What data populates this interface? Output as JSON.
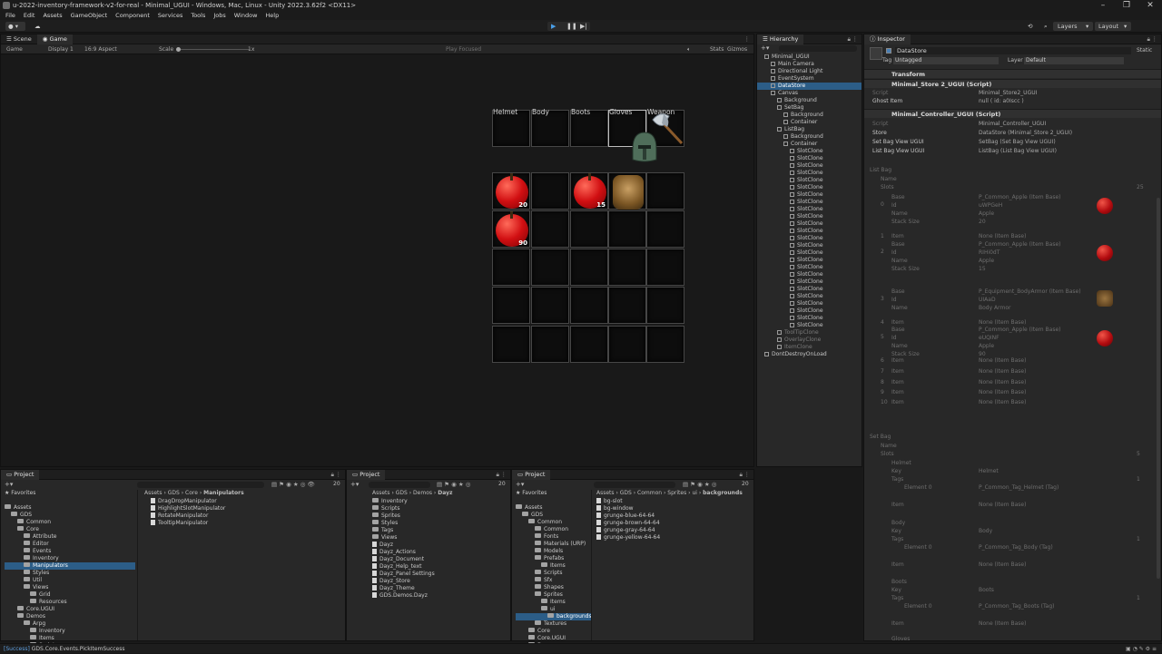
{
  "window": {
    "title": "u-2022-inventory-framework-v2-for-real - Minimal_UGUI - Windows, Mac, Linux - Unity 2022.3.62f2 <DX11>"
  },
  "menu": [
    "File",
    "Edit",
    "Assets",
    "GameObject",
    "Component",
    "Services",
    "Tools",
    "Jobs",
    "Window",
    "Help"
  ],
  "toolbar": {
    "layers": "Layers",
    "layout": "Layout"
  },
  "scene_tabs": {
    "scene": "Scene",
    "game": "Game"
  },
  "game_toolbar": {
    "mode": "Game",
    "display": "Display 1",
    "aspect": "16:9 Aspect",
    "scale_label": "Scale",
    "scale_value": "1x",
    "play_focused": "Play Focused",
    "stats": "Stats",
    "gizmos": "Gizmos"
  },
  "inventory": {
    "slot_labels": [
      "Helmet",
      "Body",
      "Boots",
      "Gloves",
      "Weapon"
    ],
    "counts": {
      "apple1": "20",
      "apple2": "15",
      "apple3": "90"
    }
  },
  "hierarchy": {
    "tab": "Hierarchy",
    "rows": [
      "Minimal_UGUI",
      "Main Camera",
      "Directional Light",
      "EventSystem",
      "DataStore",
      "Canvas",
      "Background",
      "SetBag",
      "Background",
      "Container",
      "ListBag",
      "Background",
      "Container",
      "SlotClone",
      "SlotClone",
      "SlotClone",
      "SlotClone",
      "SlotClone",
      "SlotClone",
      "SlotClone",
      "SlotClone",
      "SlotClone",
      "SlotClone",
      "SlotClone",
      "SlotClone",
      "SlotClone",
      "SlotClone",
      "SlotClone",
      "SlotClone",
      "SlotClone",
      "SlotClone",
      "SlotClone",
      "SlotClone",
      "SlotClone",
      "SlotClone",
      "SlotClone",
      "SlotClone",
      "SlotClone",
      "ToolTipClone",
      "OverlayClone",
      "ItemClone",
      "DontDestroyOnLoad"
    ],
    "selected": "DataStore"
  },
  "inspector": {
    "tab": "Inspector",
    "object_name": "DataStore",
    "static_label": "Static",
    "tag_label": "Tag",
    "tag_value": "Untagged",
    "layer_label": "Layer",
    "layer_value": "Default",
    "transform": "Transform",
    "store_script": "Minimal_Store 2_UGUI (Script)",
    "script_label": "Script",
    "store_script_value": "Minimal_Store2_UGUI",
    "ghost_label": "Ghost Item",
    "ghost_value": "null ( id: a0Iscc )",
    "controller_script": "Minimal_Controller_UGUI (Script)",
    "controller_script_value": "Minimal_Controller_UGUI",
    "store_label": "Store",
    "store_value": "DataStore (Minimal_Store 2_UGUI)",
    "setbag_label": "Set Bag View UGUI",
    "setbag_value": "SetBag (Set Bag View UGUI)",
    "listbag_label": "List Bag View UGUI",
    "listbag_value": "ListBag (List Bag View UGUI)",
    "list_bag": "List Bag",
    "name": "Name",
    "slots": "Slots",
    "slots_count": "25",
    "base": "Base",
    "id": "Id",
    "stack_size": "Stack Size",
    "item": "Item",
    "apple_base": "P_Common_Apple (Item Base)",
    "armor_base": "P_Equipment_BodyArmor (Item Base)",
    "none_base": "None (Item Base)",
    "apple": "Apple",
    "body_armor": "Body Armor",
    "id_1": "uWPGeH",
    "id_2": "RIHi0dT",
    "id_3": "UIAaD",
    "id_4": "eUQINF",
    "stack_1": "20",
    "stack_2": "15",
    "stack_3": "90",
    "set_bag": "Set Bag",
    "set_slots_count": "5",
    "helmet": "Helmet",
    "body": "Body",
    "boots": "Boots",
    "gloves": "Gloves",
    "key": "Key",
    "tags": "Tags",
    "element0": "Element 0",
    "tag_helmet": "P_Common_Tag_Helmet (Tag)",
    "tag_body": "P_Common_Tag_Body (Tag)",
    "tag_boots": "P_Common_Tag_Boots (Tag)",
    "one": "1",
    "idx": [
      "0",
      "1",
      "2",
      "3",
      "4",
      "5",
      "6",
      "7",
      "8",
      "9",
      "10"
    ]
  },
  "project1": {
    "tab": "Project",
    "favorites": "Favorites",
    "breadcrumb": [
      "Assets",
      "GDS",
      "Core",
      "Manipulators"
    ],
    "tree": [
      "Assets",
      "GDS",
      "Common",
      "Core",
      "Attribute",
      "Editor",
      "Events",
      "Inventory",
      "Manipulators",
      "Styles",
      "Util",
      "Views",
      "Grid",
      "Resources",
      "Core.UGUI",
      "Demos",
      "Arpg",
      "Inventory",
      "Items",
      "Scripts"
    ],
    "files": [
      "DragDropManipulator",
      "HighlightSlotManipulator",
      "RotateManipulator",
      "TooltipManipulator"
    ],
    "count": "20"
  },
  "project2": {
    "tab": "Project",
    "breadcrumb": [
      "Assets",
      "GDS",
      "Demos",
      "Dayz"
    ],
    "files": [
      "Inventory",
      "Scripts",
      "Sprites",
      "Styles",
      "Tags",
      "Views",
      "Dayz",
      "Dayz_Actions",
      "Dayz_Document",
      "Dayz_Help_text",
      "Dayz_Panel Settings",
      "Dayz_Store",
      "Dayz_Theme",
      "GDS.Demos.Dayz"
    ],
    "count": "20"
  },
  "project3": {
    "tab": "Project",
    "favorites": "Favorites",
    "breadcrumb": [
      "Assets",
      "GDS",
      "Common",
      "Sprites",
      "ui",
      "backgrounds"
    ],
    "tree": [
      "Assets",
      "GDS",
      "Common",
      "Common",
      "Fonts",
      "Materials (URP)",
      "Models",
      "Prefabs",
      "Items",
      "Scripts",
      "Sfx",
      "Shapes",
      "Sprites",
      "Items",
      "ui",
      "backgrounds",
      "Textures",
      "Core",
      "Core.UGUI",
      "Demos"
    ],
    "files": [
      "bg-slot",
      "bg-window",
      "grunge-blue-64-64",
      "grunge-brown-64-64",
      "grunge-gray-64-64",
      "grunge-yellow-64-64"
    ],
    "count": "20"
  },
  "status": {
    "prefix": "[Success]",
    "text": "GDS.Core.Events.PickItemSuccess"
  }
}
